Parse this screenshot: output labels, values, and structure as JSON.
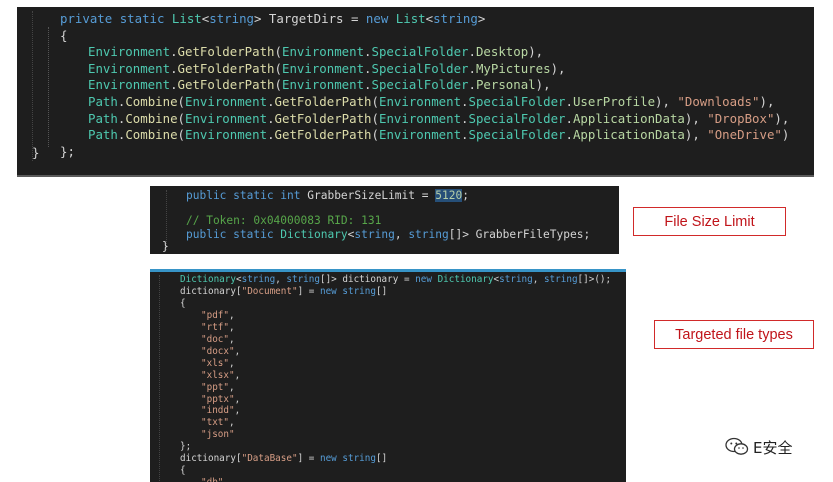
{
  "panel1": {
    "lines": [
      [
        "private static List<string> TargetDirs = new List<string>"
      ],
      [
        "{"
      ],
      [
        "Environment.GetFolderPath(Environment.SpecialFolder.Desktop),"
      ],
      [
        "Environment.GetFolderPath(Environment.SpecialFolder.MyPictures),"
      ],
      [
        "Environment.GetFolderPath(Environment.SpecialFolder.Personal),"
      ],
      [
        "Path.Combine(Environment.GetFolderPath(Environment.SpecialFolder.UserProfile), \"Downloads\"),"
      ],
      [
        "Path.Combine(Environment.GetFolderPath(Environment.SpecialFolder.ApplicationData), \"DropBox\"),"
      ],
      [
        "Path.Combine(Environment.GetFolderPath(Environment.SpecialFolder.ApplicationData), \"OneDrive\")"
      ],
      [
        "};"
      ],
      [
        "}"
      ]
    ]
  },
  "panel2": {
    "line1_prefix": "public static int GrabberSizeLimit = ",
    "line1_value": "5120",
    "line1_suffix": ";",
    "line2": "// Token: 0x04000083 RID: 131",
    "line3": "public static Dictionary<string, string[]> GrabberFileTypes;",
    "line4": "}"
  },
  "panel3": {
    "line_dict": "Dictionary<string, string[]> dictionary = new Dictionary<string, string[]>();",
    "line_doc": "dictionary[\"Document\"] = new string[]",
    "open_brace": "{",
    "doc_items": [
      "\"pdf\",",
      "\"rtf\",",
      "\"doc\",",
      "\"docx\",",
      "\"xls\",",
      "\"xlsx\",",
      "\"ppt\",",
      "\"pptx\",",
      "\"indd\",",
      "\"txt\",",
      "\"json\""
    ],
    "close_brace": "};",
    "line_db": "dictionary[\"DataBase\"] = new string[]",
    "open_brace2": "{",
    "db_items": [
      "\"db\","
    ]
  },
  "labels": {
    "file_size_limit": "File Size Limit",
    "targeted_file_types": "Targeted file types"
  },
  "watermark": {
    "text": "E安全",
    "icon": "wechat-icon"
  },
  "colors": {
    "background": "#1e1e1e",
    "keyword": "#569cd6",
    "type": "#4ec9b0",
    "method": "#dcdcaa",
    "enum_member": "#b8d7a3",
    "string": "#d69d85",
    "comment": "#57a64a",
    "label_border": "#d12a2a",
    "label_text": "#c0141a"
  }
}
